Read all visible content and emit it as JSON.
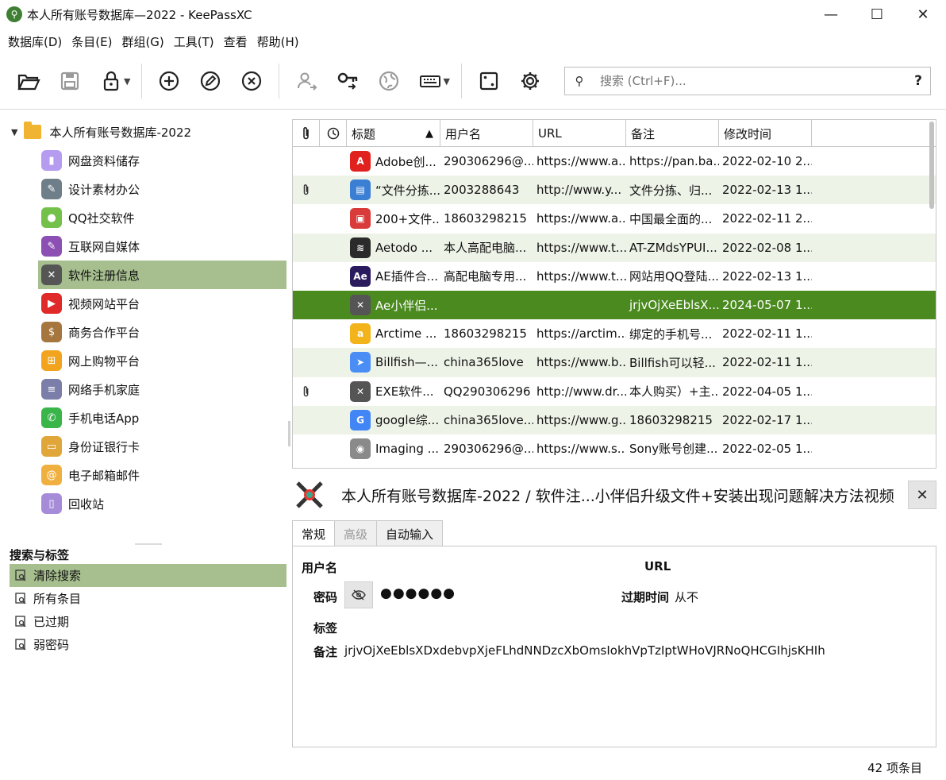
{
  "window": {
    "title": "本人所有账号数据库—2022 - KeePassXC",
    "minimize": "—",
    "maximize": "☐",
    "close": "✕"
  },
  "menu": [
    "数据库(D)",
    "条目(E)",
    "群组(G)",
    "工具(T)",
    "查看",
    "帮助(H)"
  ],
  "search": {
    "placeholder": "搜索 (Ctrl+F)...",
    "help": "?"
  },
  "tree": {
    "root": "本人所有账号数据库-2022",
    "groups": [
      {
        "label": "网盘资料储存",
        "color": "#b59cf0",
        "glyph": "▮"
      },
      {
        "label": "设计素材办公",
        "color": "#6e7f8a",
        "glyph": "✎"
      },
      {
        "label": "QQ社交软件",
        "color": "#73c04a",
        "glyph": "●"
      },
      {
        "label": "互联网自媒体",
        "color": "#8c4fb3",
        "glyph": "✎"
      },
      {
        "label": "软件注册信息",
        "color": "#555555",
        "glyph": "✕"
      },
      {
        "label": "视频网站平台",
        "color": "#e02a2a",
        "glyph": "▶"
      },
      {
        "label": "商务合作平台",
        "color": "#a5763e",
        "glyph": "$"
      },
      {
        "label": "网上购物平台",
        "color": "#f2a41f",
        "glyph": "⊞"
      },
      {
        "label": "网络手机家庭",
        "color": "#7a7ea8",
        "glyph": "≡"
      },
      {
        "label": "手机电话App",
        "color": "#39b54a",
        "glyph": "✆"
      },
      {
        "label": "身份证银行卡",
        "color": "#e0a63a",
        "glyph": "▭"
      },
      {
        "label": "电子邮箱邮件",
        "color": "#f0b040",
        "glyph": "@"
      },
      {
        "label": "回收站",
        "color": "#a68bd9",
        "glyph": "▯"
      }
    ],
    "selected_index": 4
  },
  "tags": {
    "header": "搜索与标签",
    "items": [
      "清除搜索",
      "所有条目",
      "已过期",
      "弱密码"
    ],
    "selected_index": 0
  },
  "table": {
    "headers": [
      "",
      "",
      "标题",
      "用户名",
      "URL",
      "备注",
      "修改时间"
    ],
    "rows": [
      {
        "attach": false,
        "icon": "A",
        "icon_color": "#e0211d",
        "title": "Adobe创...",
        "user": "290306296@...",
        "url": "https://www.a...",
        "notes": "https://pan.ba...",
        "modified": "2022-02-10 2..."
      },
      {
        "attach": true,
        "icon": "▤",
        "icon_color": "#3b7fd4",
        "title": "“文件分拣...",
        "user": "2003288643",
        "url": "http://www.y...",
        "notes": "文件分拣、归...",
        "modified": "2022-02-13 1..."
      },
      {
        "attach": false,
        "icon": "▣",
        "icon_color": "#d93a3a",
        "title": "200+文件...",
        "user": "18603298215",
        "url": "https://www.a...",
        "notes": "中国最全面的...",
        "modified": "2022-02-11 2..."
      },
      {
        "attach": false,
        "icon": "≋",
        "icon_color": "#2b2b2b",
        "title": "Aetodo ...",
        "user": "本人高配电脑...",
        "url": "https://www.t...",
        "notes": "AT-ZMdsYPUI...",
        "modified": "2022-02-08 1..."
      },
      {
        "attach": false,
        "icon": "Ae",
        "icon_color": "#2a1a5e",
        "title": "AE插件合...",
        "user": "高配电脑专用...",
        "url": "https://www.t...",
        "notes": "网站用QQ登陆...",
        "modified": "2022-02-13 1..."
      },
      {
        "attach": false,
        "icon": "✕",
        "icon_color": "#555555",
        "title": "Ae小伴侣...",
        "user": "",
        "url": "",
        "notes": "jrjvOjXeEblsX...",
        "modified": "2024-05-07 1..."
      },
      {
        "attach": false,
        "icon": "a",
        "icon_color": "#f3b41b",
        "title": "Arctime ...",
        "user": "18603298215",
        "url": "https://arctim...",
        "notes": "绑定的手机号...",
        "modified": "2022-02-11 1..."
      },
      {
        "attach": false,
        "icon": "➤",
        "icon_color": "#4a8ef5",
        "title": "Billfish—...",
        "user": "china365love",
        "url": "https://www.b...",
        "notes": "Billfish可以轻...",
        "modified": "2022-02-11 1..."
      },
      {
        "attach": true,
        "icon": "✕",
        "icon_color": "#555555",
        "title": "EXE软件...",
        "user": "QQ290306296",
        "url": "http://www.dr...",
        "notes": "本人购买）+主...",
        "modified": "2022-04-05 1..."
      },
      {
        "attach": false,
        "icon": "G",
        "icon_color": "#4285f4",
        "title": "google综...",
        "user": "china365love...",
        "url": "https://www.g...",
        "notes": "18603298215",
        "modified": "2022-02-17 1..."
      },
      {
        "attach": false,
        "icon": "◉",
        "icon_color": "#8a8a8a",
        "title": "Imaging ...",
        "user": "290306296@...",
        "url": "https://www.s...",
        "notes": "Sony账号创建...",
        "modified": "2022-02-05 1..."
      }
    ],
    "selected_index": 5
  },
  "detail": {
    "title": "本人所有账号数据库-2022 / 软件注...小伴侣升级文件+安装出现问题解决方法视频",
    "tabs": [
      "常规",
      "高级",
      "自动输入"
    ],
    "username_label": "用户名",
    "url_label": "URL",
    "password_label": "密码",
    "password_value": "●●●●●●",
    "expiry_label": "过期时间",
    "expiry_value": "从不",
    "tags_label": "标签",
    "notes_label": "备注",
    "notes_value": "jrjvOjXeEblsXDxdebvpXjeFLhdNNDzcXbOmsIokhVpTzIptWHoVJRNoQHCGIhjsKHIh"
  },
  "status": "42 项条目",
  "colors": {
    "accent_selected": "#4a8a1f",
    "group_selected": "#a7bf8f",
    "row_alt": "#eef3e8"
  }
}
